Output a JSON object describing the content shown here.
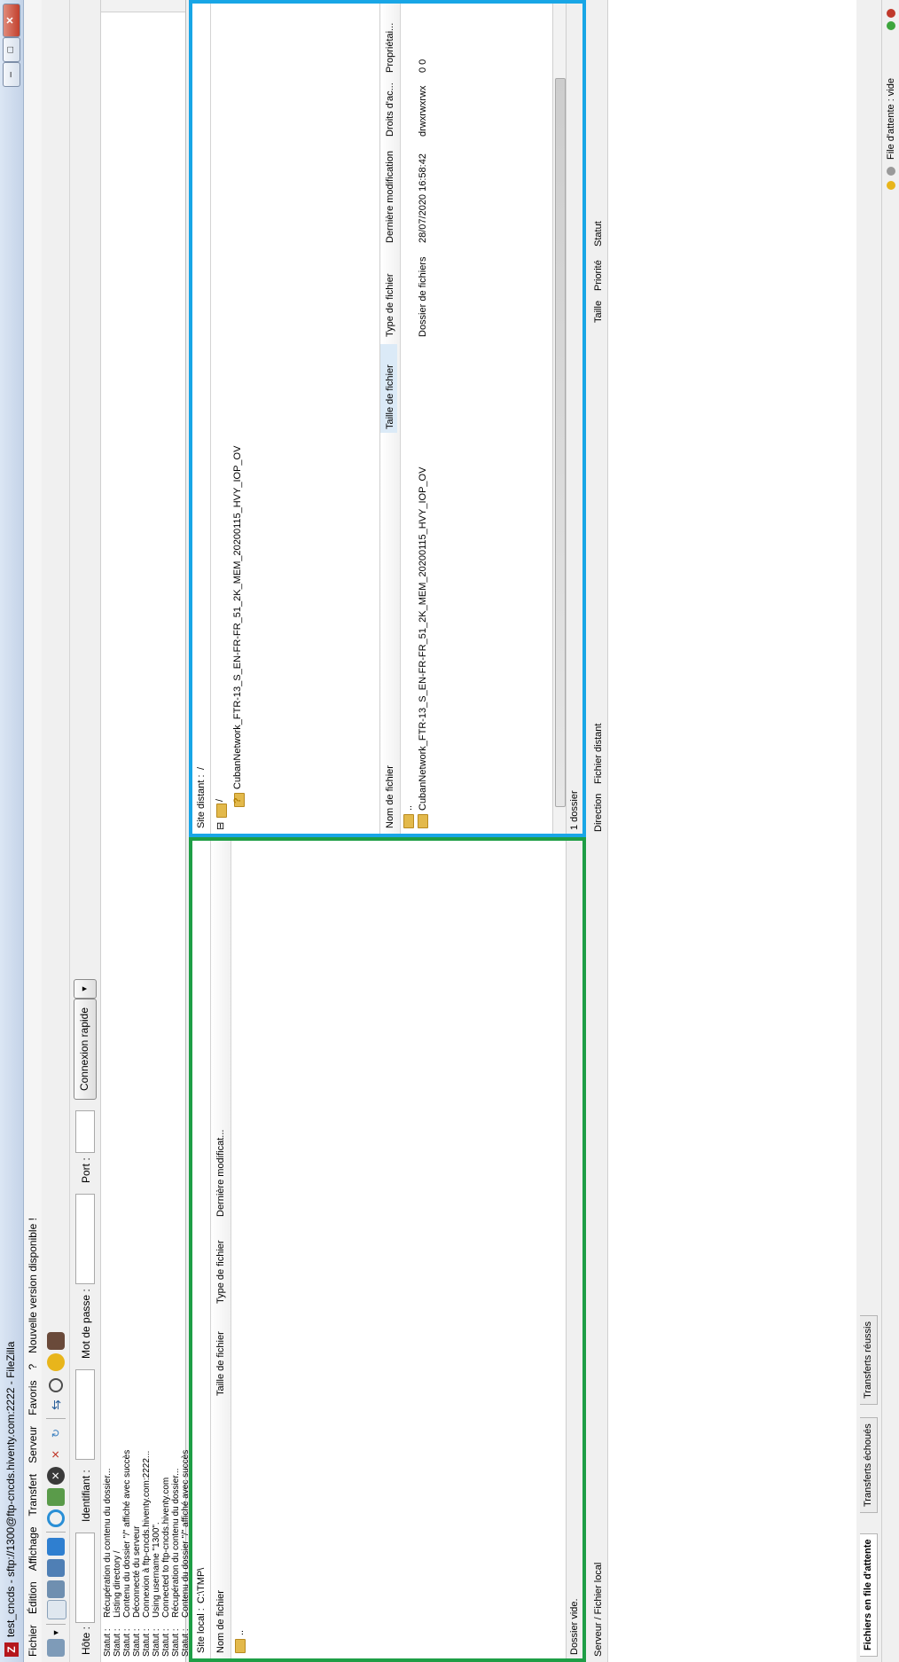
{
  "window": {
    "title": "test_cncds - sftp://1300@ftp-cncds.hiventy.com:2222 - FileZilla",
    "minimize": "–",
    "maximize": "□",
    "close": "✕"
  },
  "menu": [
    "Fichier",
    "Édition",
    "Affichage",
    "Transfert",
    "Serveur",
    "Favoris",
    "?",
    "Nouvelle version disponible !"
  ],
  "quickconnect": {
    "host_label": "Hôte :",
    "user_label": "Identifiant :",
    "pass_label": "Mot de passe :",
    "port_label": "Port :",
    "button": "Connexion rapide",
    "dropdown": "▼"
  },
  "log": [
    {
      "k": "Statut :",
      "v": "Récupération du contenu du dossier..."
    },
    {
      "k": "Statut :",
      "v": "Listing directory /"
    },
    {
      "k": "Statut :",
      "v": "Contenu du dossier \"/\" affiché avec succès"
    },
    {
      "k": "Statut :",
      "v": "Déconnecté du serveur"
    },
    {
      "k": "Statut :",
      "v": "Connexion à ftp-cncds.hiventy.com:2222..."
    },
    {
      "k": "Statut :",
      "v": "Using username \"1300\"."
    },
    {
      "k": "Statut :",
      "v": "Connected to ftp-cncds.hiventy.com"
    },
    {
      "k": "Statut :",
      "v": "Récupération du contenu du dossier..."
    },
    {
      "k": "Statut :",
      "v": "Contenu du dossier \"/\" affiché avec succès"
    }
  ],
  "local": {
    "site_label": "Site local :",
    "path": "C:\\TMP\\",
    "columns": [
      "Nom de fichier",
      "Taille de fichier",
      "Type de fichier",
      "Dernière modificat..."
    ],
    "rows": [
      {
        "name": ".."
      }
    ],
    "status": "Dossier vide."
  },
  "remote": {
    "site_label": "Site distant :",
    "path": "/",
    "tree": [
      {
        "label": "/"
      },
      {
        "label": "CubanNetwork_FTR-13_S_EN-FR-FR_51_2K_MEM_20200115_HVY_IOP_OV"
      }
    ],
    "columns": [
      "Nom de fichier",
      "Taille de fichier",
      "Type de fichier",
      "Dernière modification",
      "Droits d'ac...",
      "Propriétai..."
    ],
    "rows": [
      {
        "name": "..",
        "size": "",
        "type": "",
        "modified": "",
        "perms": "",
        "owner": ""
      },
      {
        "name": "CubanNetwork_FTR-13_S_EN-FR-FR_51_2K_MEM_20200115_HVY_IOP_OV",
        "size": "",
        "type": "Dossier de fichiers",
        "modified": "28/07/2020 16:58:42",
        "perms": "drwxrwxrwx",
        "owner": "0 0"
      }
    ],
    "status": "1 dossier"
  },
  "queue": {
    "columns": [
      "Serveur / Fichier local",
      "Direction",
      "Fichier distant",
      "Taille",
      "Priorité",
      "Statut"
    ]
  },
  "tabs": [
    "Fichiers en file d'attente",
    "Transferts échoués",
    "Transferts réussis"
  ],
  "statusbar": {
    "queue": "File d'attente : vide"
  },
  "colors": {
    "local_highlight": "#1e9e46",
    "remote_highlight": "#18a6e6",
    "app_icon": "#b5171c"
  }
}
